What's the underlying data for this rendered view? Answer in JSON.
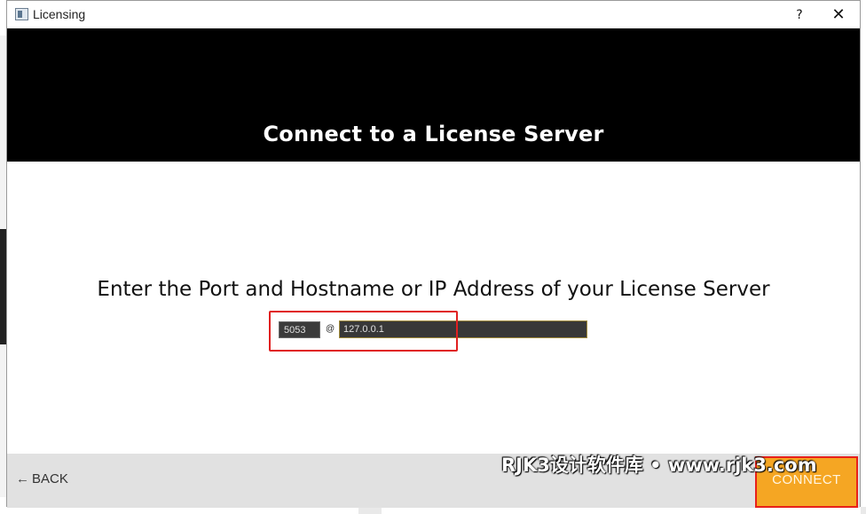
{
  "window": {
    "title": "Licensing",
    "help_glyph": "?",
    "close_glyph": "✕"
  },
  "header": {
    "title": "Connect to a License Server"
  },
  "main": {
    "prompt": "Enter the Port and Hostname or IP Address of your License Server",
    "port_value": "5053",
    "separator": "@",
    "host_value": "127.0.0.1"
  },
  "footer": {
    "back_label": "BACK",
    "back_arrow": "←",
    "connect_label": "CONNECT"
  },
  "overlay": {
    "watermark_text": "RJK3设计软件库 • www.rjk3.com"
  },
  "colors": {
    "header_bg": "#000000",
    "connect_bg": "#f5a623",
    "highlight": "#e02020",
    "input_bg": "#3b3b3b"
  }
}
